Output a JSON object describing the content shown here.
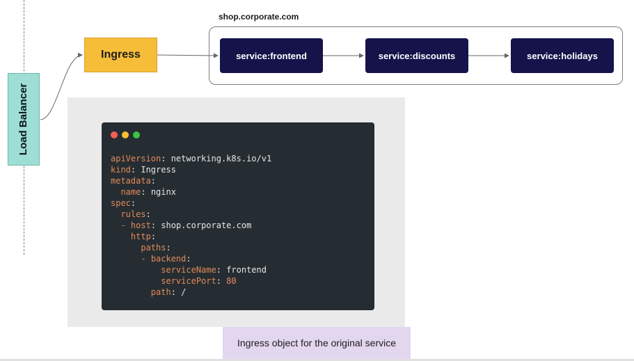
{
  "load_balancer": {
    "label": "Load Balancer"
  },
  "ingress": {
    "label": "Ingress"
  },
  "domain_group": {
    "label": "shop.corporate.com"
  },
  "services": [
    {
      "label": "service:frontend"
    },
    {
      "label": "service:discounts"
    },
    {
      "label": "service:holidays"
    }
  ],
  "code": {
    "lines": [
      {
        "indent": "",
        "prefix": "",
        "key": "apiVersion",
        "sep": ": ",
        "value": "networking.k8s.io/v1"
      },
      {
        "indent": "",
        "prefix": "",
        "key": "kind",
        "sep": ": ",
        "value": "Ingress"
      },
      {
        "indent": "",
        "prefix": "",
        "key": "metadata",
        "sep": ":",
        "value": ""
      },
      {
        "indent": "  ",
        "prefix": "",
        "key": "name",
        "sep": ": ",
        "value": "nginx"
      },
      {
        "indent": "",
        "prefix": "",
        "key": "spec",
        "sep": ":",
        "value": ""
      },
      {
        "indent": "  ",
        "prefix": "",
        "key": "rules",
        "sep": ":",
        "value": ""
      },
      {
        "indent": "  ",
        "prefix": "- ",
        "key": "host",
        "sep": ": ",
        "value": "shop.corporate.com"
      },
      {
        "indent": "    ",
        "prefix": "",
        "key": "http",
        "sep": ":",
        "value": ""
      },
      {
        "indent": "      ",
        "prefix": "",
        "key": "paths",
        "sep": ":",
        "value": ""
      },
      {
        "indent": "      ",
        "prefix": "- ",
        "key": "backend",
        "sep": ":",
        "value": ""
      },
      {
        "indent": "          ",
        "prefix": "",
        "key": "serviceName",
        "sep": ": ",
        "value": "frontend"
      },
      {
        "indent": "          ",
        "prefix": "",
        "key": "servicePort",
        "sep": ": ",
        "value": "80",
        "numeric": true
      },
      {
        "indent": "        ",
        "prefix": "",
        "key": "path",
        "sep": ": ",
        "value": "/"
      }
    ]
  },
  "caption": {
    "text": "Ingress object for the original service"
  },
  "colors": {
    "load_balancer_fill": "#9fded4",
    "ingress_fill": "#f6bd38",
    "service_fill": "#15134a",
    "code_background": "#262d32",
    "code_key": "#e28a5a",
    "caption_fill": "#e3d6ef"
  }
}
